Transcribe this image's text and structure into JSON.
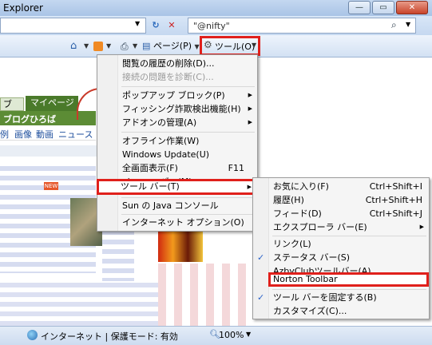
{
  "window": {
    "title": "Explorer",
    "controls": {
      "minimize": "—",
      "maximize": "▭",
      "close": "✕"
    }
  },
  "address_bar": {
    "refresh": "↻",
    "stop": "✕",
    "search_value": "\"@nifty\"",
    "search_btn": "⌕"
  },
  "command_bar": {
    "page_label": "ページ(P)",
    "tools_label": "ツール(O)"
  },
  "page": {
    "tabs": [
      "ブ",
      "マイページ"
    ],
    "blog_link": "ブログひろば",
    "nav": [
      "例",
      "画像",
      "動画",
      "ニュース"
    ],
    "new_badge": "NEW"
  },
  "tools_menu": {
    "items": [
      {
        "label": "閲覧の履歴の削除(D)..."
      },
      {
        "label": "接続の問題を診断(C)...",
        "disabled": true
      },
      {
        "label": "ポップアップ ブロック(P)",
        "submenu": true
      },
      {
        "label": "フィッシング詐欺検出機能(H)",
        "submenu": true
      },
      {
        "label": "アドオンの管理(A)",
        "submenu": true
      },
      {
        "label": "オフライン作業(W)"
      },
      {
        "label": "Windows Update(U)"
      },
      {
        "label": "全画面表示(F)",
        "shortcut": "F11"
      },
      {
        "label": "メニュー バー(M)"
      },
      {
        "label": "ツール バー(T)",
        "submenu": true
      },
      {
        "label": "Sun の Java コンソール"
      },
      {
        "label": "インターネット オプション(O)"
      }
    ]
  },
  "toolbar_submenu": {
    "items": [
      {
        "label": "お気に入り(F)",
        "shortcut": "Ctrl+Shift+I"
      },
      {
        "label": "履歴(H)",
        "shortcut": "Ctrl+Shift+H"
      },
      {
        "label": "フィード(D)",
        "shortcut": "Ctrl+Shift+J"
      },
      {
        "label": "エクスプローラ バー(E)",
        "submenu": true
      },
      {
        "label": "リンク(L)"
      },
      {
        "label": "ステータス バー(S)",
        "checked": true
      },
      {
        "label": "AzbyClubツールバー(A)"
      },
      {
        "label": "Norton Toolbar"
      },
      {
        "label": "ツール バーを固定する(B)",
        "checked": true
      },
      {
        "label": "カスタマイズ(C)..."
      }
    ]
  },
  "status_bar": {
    "zone": "インターネット | 保護モード: 有効",
    "zoom": "100%"
  },
  "colors": {
    "highlight_frame": "#e0201b",
    "page_tab_green": "#4a7a2a",
    "check_blue": "#2a62c9"
  },
  "icons": {
    "home": "home-icon",
    "feeds": "feeds-icon",
    "print": "print-icon",
    "tools": "gear-icon",
    "internet": "globe-icon",
    "zoom": "zoom-icon"
  }
}
